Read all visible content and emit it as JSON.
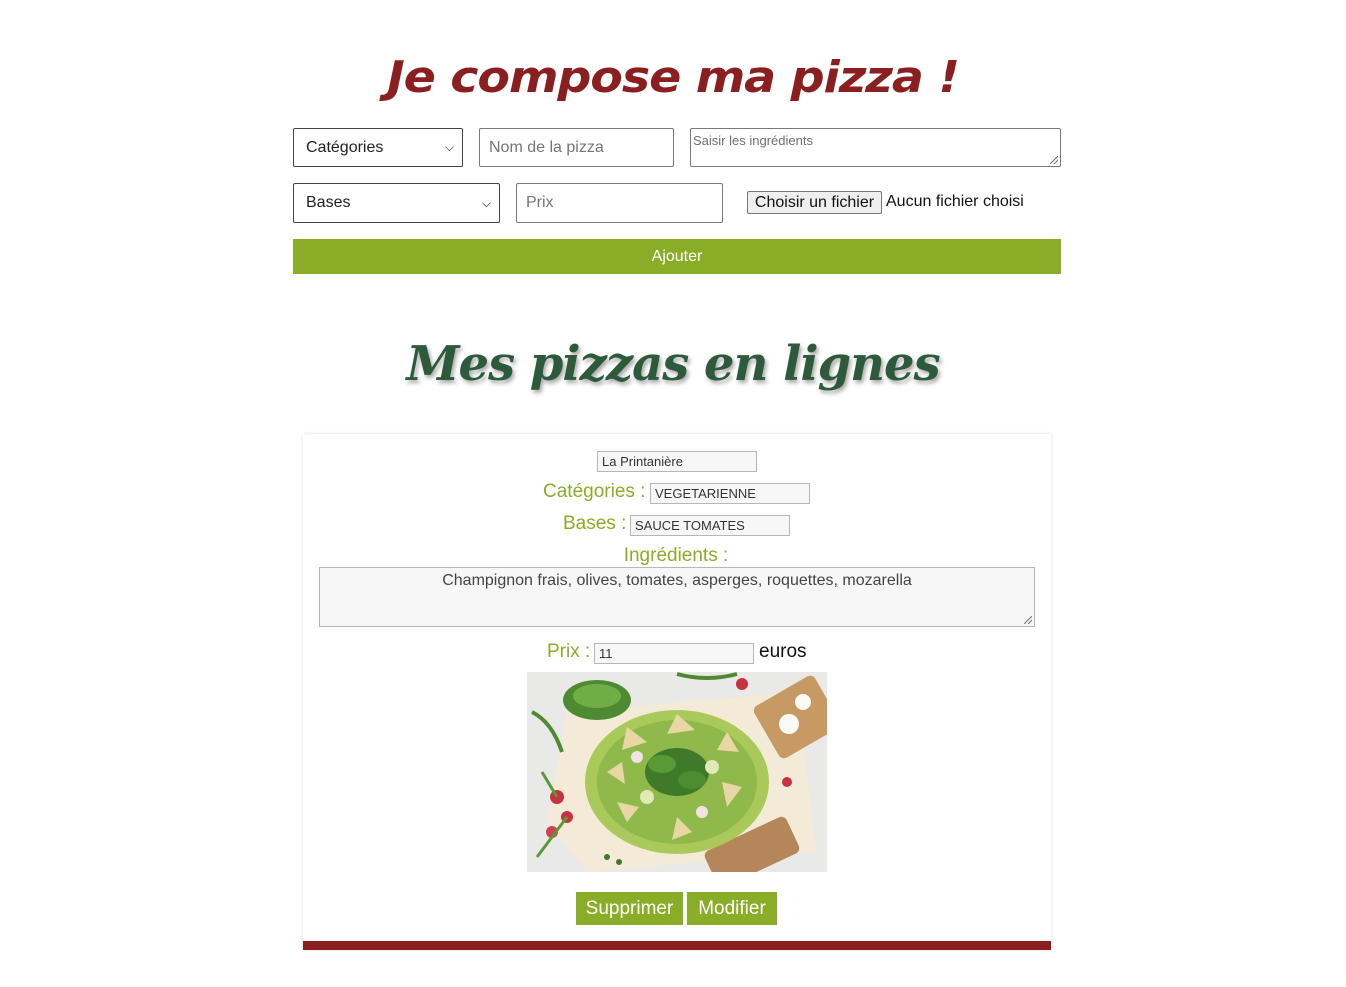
{
  "header": {
    "title": "Je compose ma pizza !"
  },
  "form": {
    "category_select": {
      "selected": "Catégories"
    },
    "name_input": {
      "placeholder": "Nom de la pizza"
    },
    "ingredients_textarea": {
      "placeholder": "Saisir les ingrédients"
    },
    "base_select": {
      "selected": "Bases"
    },
    "price_input": {
      "placeholder": "Prix"
    },
    "file": {
      "button_label": "Choisir un fichier",
      "status": "Aucun fichier choisi"
    },
    "add_button": "Ajouter"
  },
  "list": {
    "title": "Mes pizzas en lignes",
    "pizzas": [
      {
        "name": "La Printanière",
        "category_label": "Catégories :",
        "category": "VEGETARIENNE",
        "base_label": "Bases :",
        "base": "SAUCE TOMATES",
        "ingredients_label": "Ingrédients :",
        "ingredients": "Champignon frais, olives, tomates, asperges, roquettes, mozarella",
        "price_label": "Prix :",
        "price": "11",
        "price_unit": "euros",
        "image_icon": "pizza-photo",
        "delete_label": "Supprimer",
        "edit_label": "Modifier"
      }
    ]
  },
  "colors": {
    "brand_red": "#8b1f20",
    "accent_green": "#8aad28",
    "title_green": "#2d5a3b"
  }
}
